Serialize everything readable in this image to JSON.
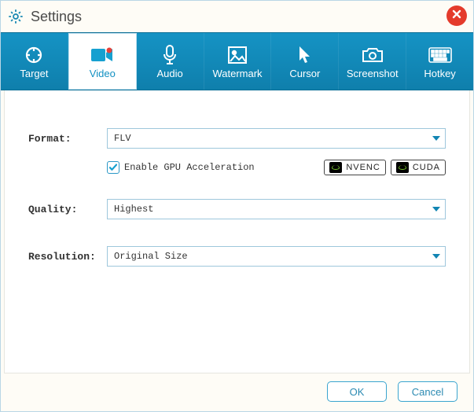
{
  "window": {
    "title": "Settings"
  },
  "tabs": {
    "target": "Target",
    "video": "Video",
    "audio": "Audio",
    "watermark": "Watermark",
    "cursor": "Cursor",
    "screenshot": "Screenshot",
    "hotkey": "Hotkey",
    "active": "video"
  },
  "form": {
    "format_label": "Format:",
    "format_value": "FLV",
    "gpu_checkbox": {
      "checked": true,
      "label": "Enable GPU Acceleration"
    },
    "badges": {
      "nvenc": "NVENC",
      "cuda": "CUDA"
    },
    "quality_label": "Quality:",
    "quality_value": "Highest",
    "resolution_label": "Resolution:",
    "resolution_value": "Original Size"
  },
  "footer": {
    "ok": "OK",
    "cancel": "Cancel"
  }
}
